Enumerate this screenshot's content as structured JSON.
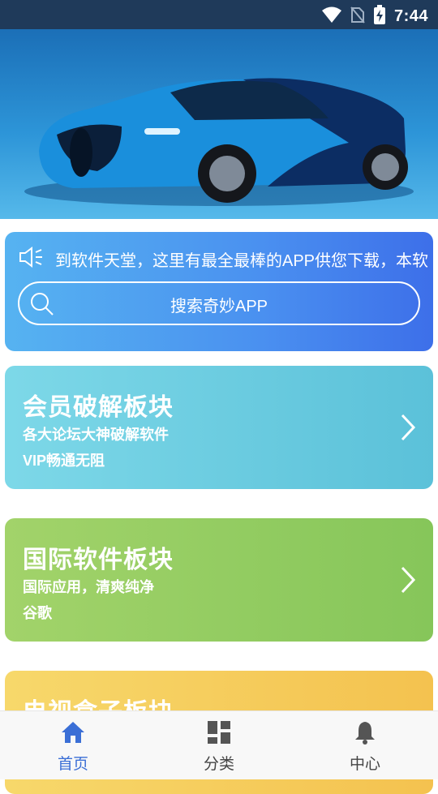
{
  "status_bar": {
    "time": "7:44",
    "icons": [
      "wifi-icon",
      "no-sim-icon",
      "battery-charging-icon"
    ]
  },
  "banner": {
    "image": "blue sports car",
    "colors": {
      "body": "#1a8fdc",
      "dark": "#0c2d63"
    }
  },
  "notice": {
    "text": "到软件天堂，这里有最全最棒的APP供您下载，本软",
    "search_placeholder": "搜索奇妙APP"
  },
  "modules": [
    {
      "title": "会员破解板块",
      "line1": "各大论坛大神破解软件",
      "line2": "VIP畅通无阻"
    },
    {
      "title": "国际软件板块",
      "line1": "国际应用，清爽纯净",
      "line2": "谷歌"
    },
    {
      "title": "电视盒子板块",
      "line1": "",
      "line2": ""
    }
  ],
  "nav": [
    {
      "label": "首页",
      "icon": "home-icon",
      "active": true
    },
    {
      "label": "分类",
      "icon": "grid-icon",
      "active": false
    },
    {
      "label": "中心",
      "icon": "bell-icon",
      "active": false
    }
  ],
  "colors": {
    "accent": "#3b6fd6",
    "status_bar": "#1f3a5a"
  }
}
